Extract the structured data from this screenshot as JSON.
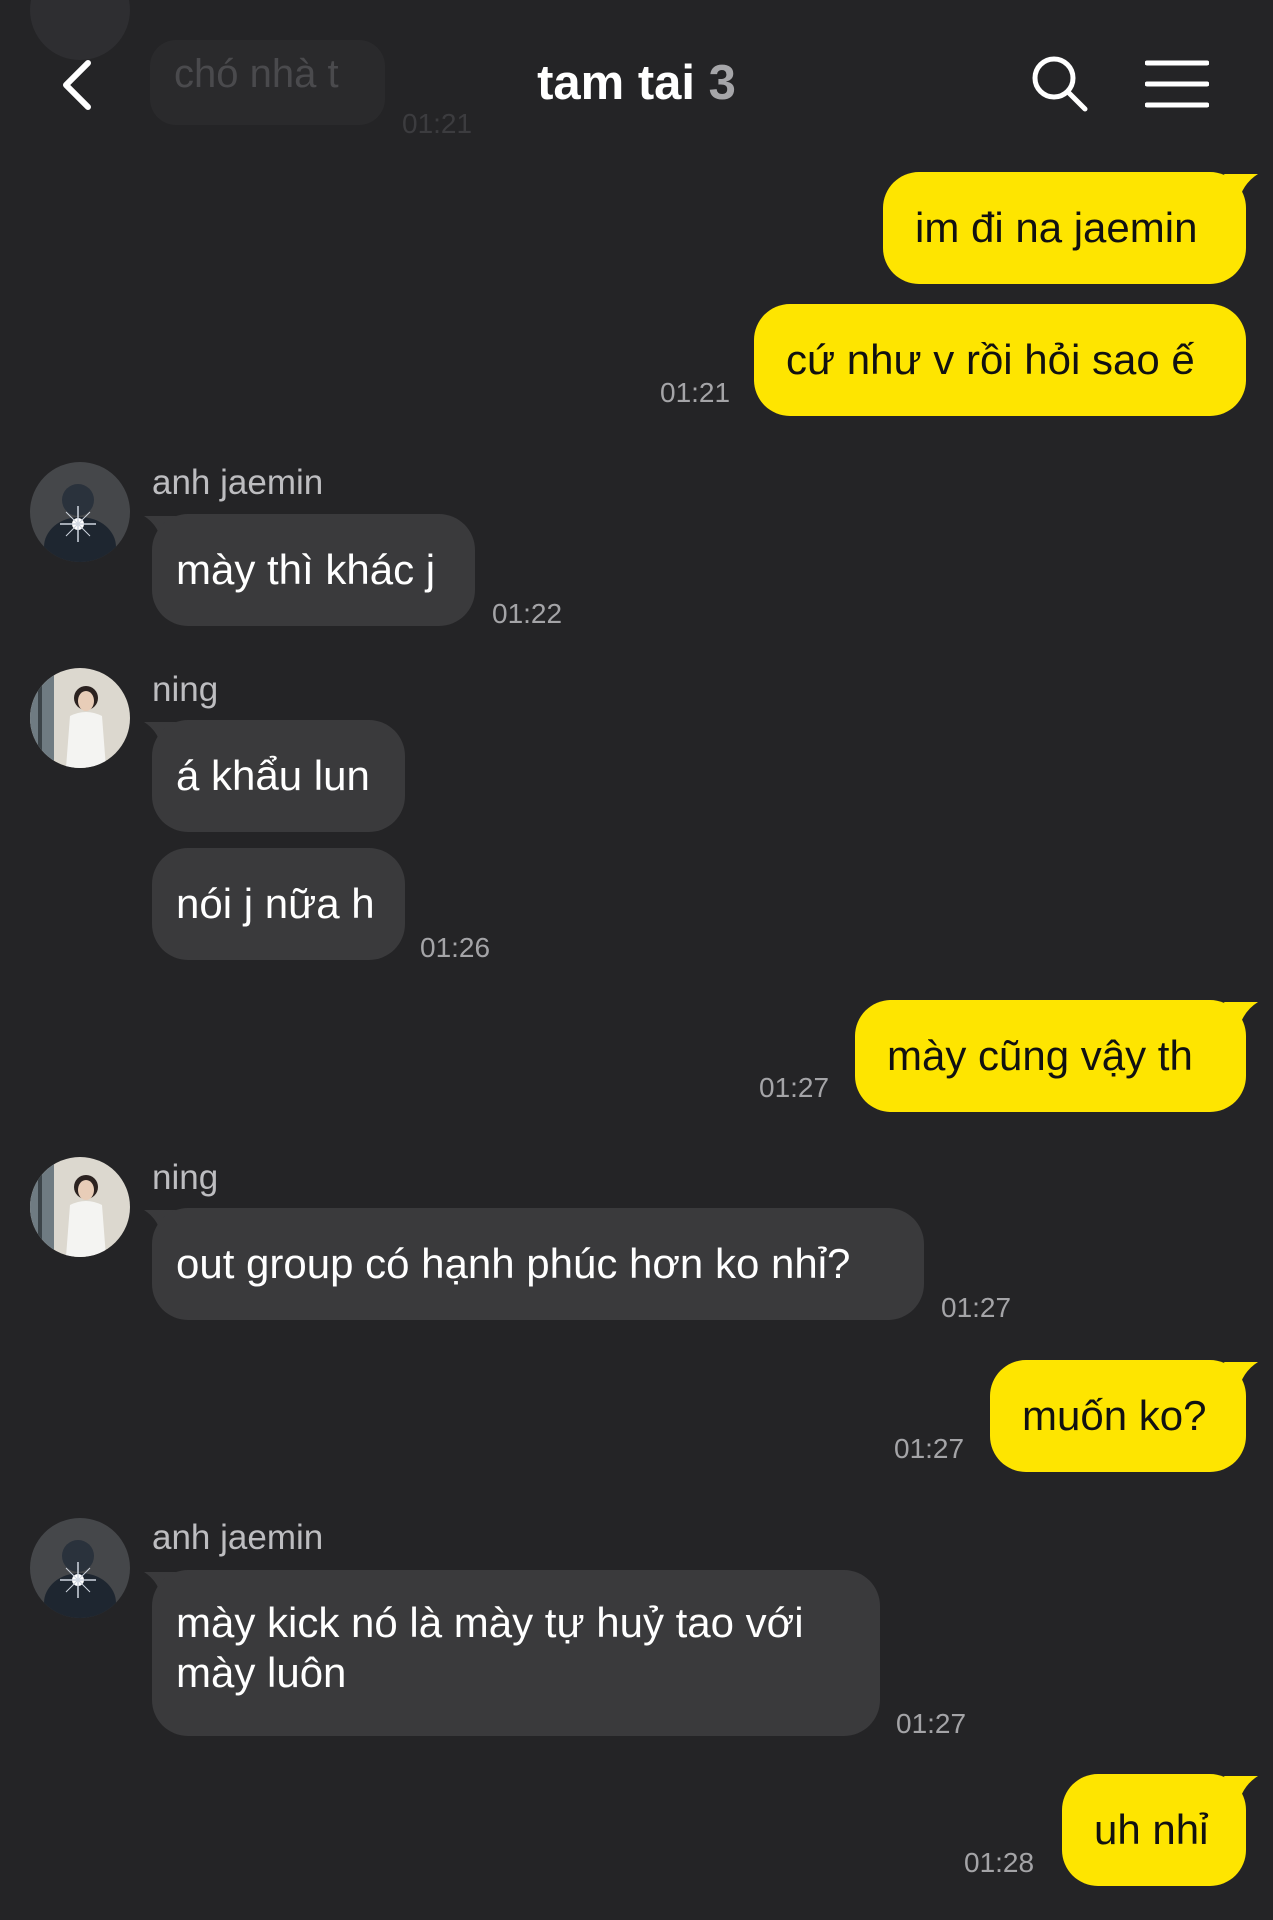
{
  "header": {
    "title": "tam tai",
    "member_count": "3",
    "back_icon": "chevron-left-icon",
    "search_icon": "search-icon",
    "menu_icon": "hamburger-menu-icon"
  },
  "previous_message": {
    "text": "chó nhà t",
    "time": "01:21"
  },
  "messages": [
    {
      "id": "m1",
      "side": "out",
      "text": "im đi na jaemin",
      "time": ""
    },
    {
      "id": "m2",
      "side": "out",
      "text": "cứ như v rồi hỏi sao ế",
      "time": "01:21"
    },
    {
      "id": "m3",
      "side": "in",
      "sender": "anh jaemin",
      "text": "mày thì khác j",
      "time": "01:22"
    },
    {
      "id": "m4",
      "side": "in",
      "sender": "ning",
      "text": "á khẩu lun",
      "time": ""
    },
    {
      "id": "m5",
      "side": "in",
      "sender": "",
      "text": "nói j nữa h",
      "time": "01:26"
    },
    {
      "id": "m6",
      "side": "out",
      "text": "mày cũng vậy th",
      "time": "01:27"
    },
    {
      "id": "m7",
      "side": "in",
      "sender": "ning",
      "text": "out group có hạnh phúc hơn ko nhỉ?",
      "time": "01:27"
    },
    {
      "id": "m8",
      "side": "out",
      "text": "muốn ko?",
      "time": "01:27"
    },
    {
      "id": "m9",
      "side": "in",
      "sender": "anh jaemin",
      "text_lines": [
        "mày kick nó là mày tự huỷ tao với",
        "mày luôn"
      ],
      "time": "01:27"
    },
    {
      "id": "m10",
      "side": "out",
      "text": "uh nhỉ",
      "time": "01:28"
    }
  ],
  "colors": {
    "background": "#242426",
    "outgoing_bubble": "#fee500",
    "incoming_bubble": "#3a3a3c",
    "timestamp": "#a4a4a7"
  }
}
